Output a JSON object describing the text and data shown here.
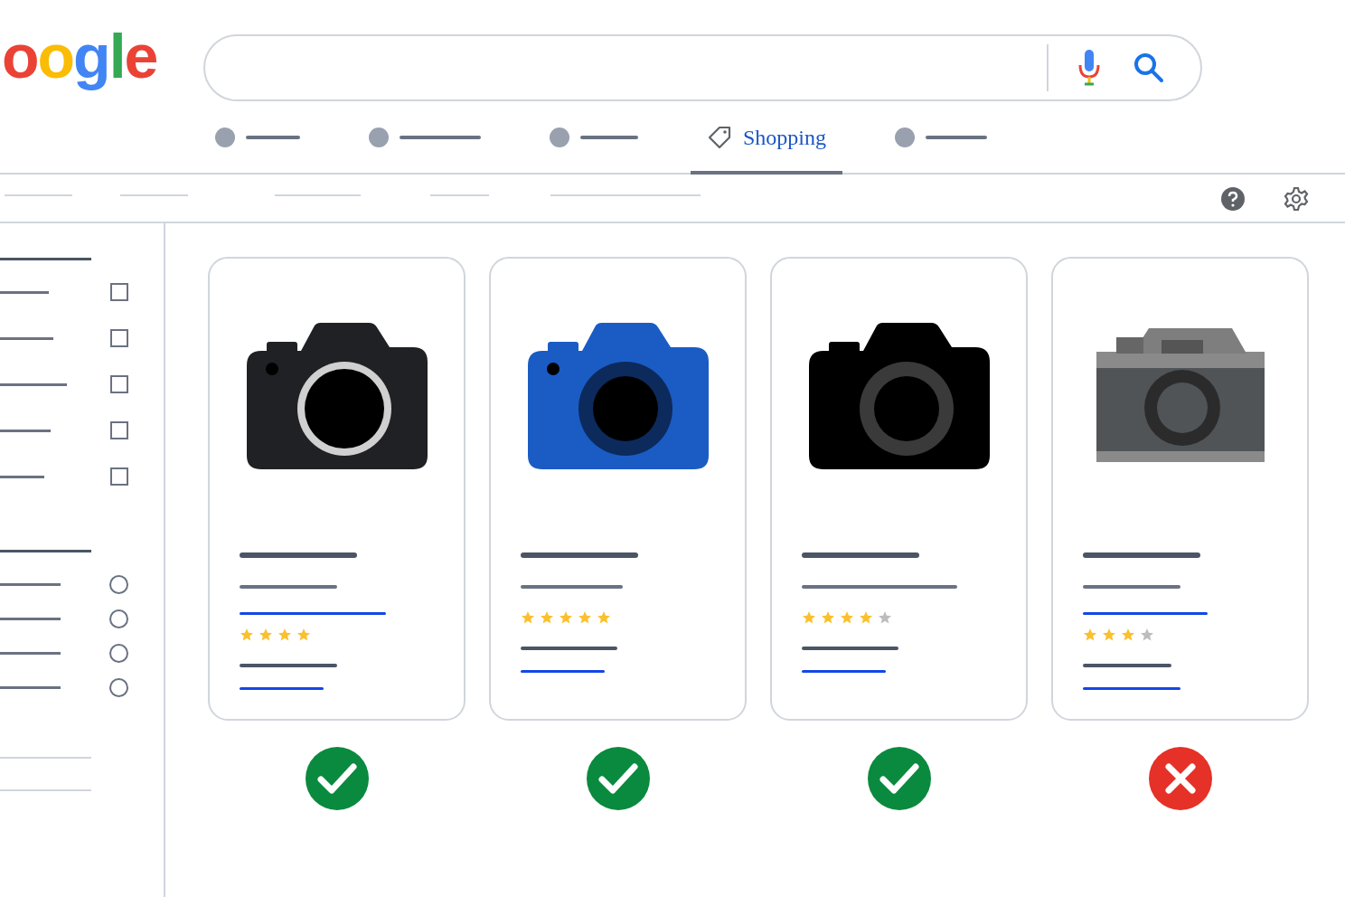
{
  "logo": {
    "text": "oogle"
  },
  "search": {
    "kind": "pill"
  },
  "tabs": [
    {
      "kind": "placeholder",
      "selected": false
    },
    {
      "kind": "placeholder",
      "selected": false
    },
    {
      "kind": "placeholder",
      "selected": false
    },
    {
      "kind": "labeled",
      "label": "Shopping",
      "selected": true
    },
    {
      "kind": "placeholder",
      "selected": false
    }
  ],
  "filters": {
    "checkboxes": [
      {
        "checked": false
      },
      {
        "checked": false
      },
      {
        "checked": false
      },
      {
        "checked": false
      },
      {
        "checked": false
      }
    ],
    "radios": [
      {
        "selected": false
      },
      {
        "selected": false
      },
      {
        "selected": false
      },
      {
        "selected": false
      }
    ]
  },
  "products": [
    {
      "camera": {
        "kind": "modern",
        "color": "#202124"
      },
      "link_line": true,
      "star_slots": [
        true,
        true,
        true,
        true
      ],
      "approved": true
    },
    {
      "camera": {
        "kind": "modern",
        "color": "#1a5cc4"
      },
      "link_line": false,
      "star_slots": [
        true,
        true,
        true,
        true,
        true
      ],
      "approved": true
    },
    {
      "camera": {
        "kind": "modern",
        "color": "#000000"
      },
      "link_line": false,
      "star_slots": [
        true,
        true,
        true,
        true,
        false
      ],
      "approved": true
    },
    {
      "camera": {
        "kind": "retro",
        "color": "#505456"
      },
      "link_line": true,
      "star_slots": [
        true,
        true,
        true,
        false
      ],
      "approved": false
    }
  ]
}
